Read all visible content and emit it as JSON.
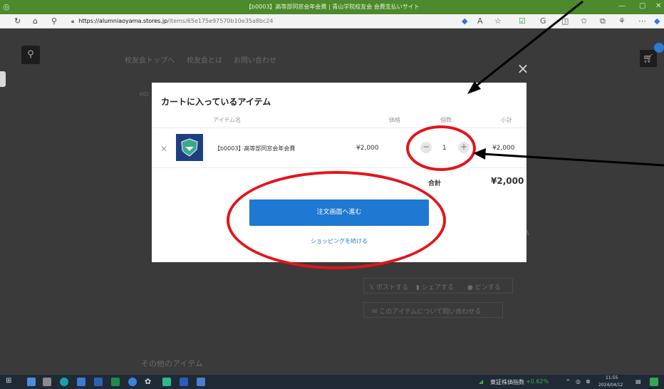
{
  "browser": {
    "window_title": "【b0003】高等部同窓会年会費 | 青山学院校友会 会費支払いサイト",
    "url_host": "https://alumniaoyama.stores.jp",
    "url_path": "/items/65e175e97570b10e35a8bc24"
  },
  "page": {
    "nav_top": "校友会トップへ",
    "nav_about": "校友会とは",
    "nav_contact": "お問い合わせ",
    "breadcrumb_fragment": "HO",
    "side_letter": "A",
    "share_post": "ポストする",
    "share_facebook": "シェアする",
    "share_pin": "ピンする",
    "inquiry": "このアイテムについて問い合わせる",
    "other_items": "その他のアイテム"
  },
  "cart_modal": {
    "title": "カートに入っているアイテム",
    "col_item": "アイテム名",
    "col_price": "価格",
    "col_qty": "個数",
    "col_subtotal": "小計",
    "item": {
      "name": "【b0003】高等部同窓会年会費",
      "price": "¥2,000",
      "qty": "1",
      "subtotal": "¥2,000"
    },
    "qty_minus": "−",
    "qty_plus": "+",
    "total_label": "合計",
    "total_value": "¥2,000",
    "checkout_button": "注文画面へ進む",
    "continue_link": "ショッピングを続ける",
    "close_symbol": "×"
  },
  "taskbar": {
    "stock_label": "東証株価指数",
    "stock_change": "+0.62%",
    "time": "11:55",
    "date": "2024/04/12"
  },
  "colors": {
    "annotation": "#e4141b",
    "checkout": "#1f78d1",
    "titlebar": "#4c8a2c"
  }
}
